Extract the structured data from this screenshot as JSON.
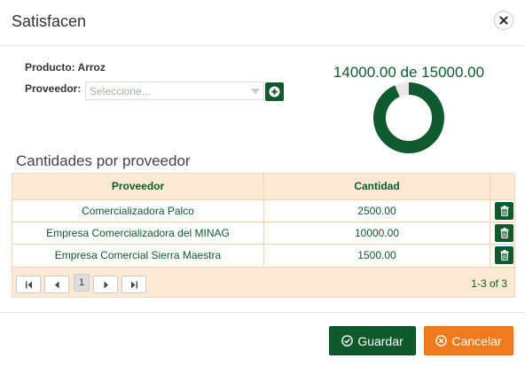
{
  "dialog": {
    "title": "Satisfacen"
  },
  "form": {
    "product_label": "Producto: Arroz",
    "provider_label": "Proveedor:",
    "provider_placeholder": "Seleccione..."
  },
  "gauge": {
    "text": "14000.00 de 15000.00",
    "current": 14000,
    "total": 15000,
    "fill_color": "#0f5a2f",
    "track_color": "#e8e8e8"
  },
  "section": {
    "title": "Cantidades por proveedor"
  },
  "table": {
    "headers": [
      "Proveedor",
      "Cantidad"
    ],
    "rows": [
      {
        "provider": "Comercializadora Palco",
        "quantity": "2500.00"
      },
      {
        "provider": "Empresa Comercializadora del MINAG",
        "quantity": "10000.00"
      },
      {
        "provider": "Empresa Comercial Sierra Maestra",
        "quantity": "1500.00"
      }
    ],
    "pager": {
      "current_page": "1",
      "info": "1-3 of 3"
    }
  },
  "footer": {
    "save_label": "Guardar",
    "cancel_label": "Cancelar"
  },
  "colors": {
    "primary": "#0e5a2b",
    "accent": "#f07a1c",
    "grid_bg": "#fde9d4"
  }
}
